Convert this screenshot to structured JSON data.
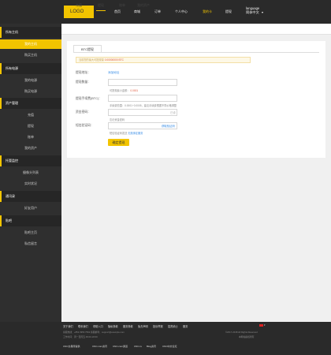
{
  "header": {
    "logo": "LOGO",
    "nav": [
      "首页",
      "商城",
      "订单",
      "个人中心",
      "我的卡",
      "提现"
    ],
    "active_nav": "我的卡",
    "lang_title": "language",
    "lang_value": "简体中文"
  },
  "sidebar": [
    {
      "type": "head",
      "label": "所有主机"
    },
    {
      "type": "sub",
      "label": "我的主机",
      "active": true
    },
    {
      "type": "sub",
      "label": "购买主机"
    },
    {
      "type": "head",
      "label": "所有电源"
    },
    {
      "type": "sub",
      "label": "我的电源"
    },
    {
      "type": "sub",
      "label": "购买电源"
    },
    {
      "type": "head",
      "label": "资产管理"
    },
    {
      "type": "sub",
      "label": "充值"
    },
    {
      "type": "sub",
      "label": "提现"
    },
    {
      "type": "sub",
      "label": "账单"
    },
    {
      "type": "sub",
      "label": "我的资产"
    },
    {
      "type": "head",
      "label": "托管监控"
    },
    {
      "type": "sub",
      "label": "摄像头列表"
    },
    {
      "type": "sub",
      "label": "实时状况"
    },
    {
      "type": "head",
      "label": "通讯录"
    },
    {
      "type": "sub",
      "label": "好友用户"
    },
    {
      "type": "head",
      "label": "贴吧"
    },
    {
      "type": "sub",
      "label": "贴吧主页"
    },
    {
      "type": "sub",
      "label": "私信留言"
    }
  ],
  "tabs": [
    "充值",
    "提现",
    "账单",
    "我的资产"
  ],
  "active_tab": "提现",
  "subtab": "BTC提现",
  "notice": {
    "text": "当前您的最大可提现量",
    "amount": "0.00000000 BTC"
  },
  "form": {
    "address_label": "提现地址：",
    "address_value": "添加地址",
    "amount_label": "提现数量：",
    "amount_hint": "可提现最小金额：",
    "amount_hint_value": "0.0001",
    "fee_label": "提现手续费(BTC)：",
    "fee_hint": "手续费范围：0.0001~0.0005，建议手续费根据不同价格调整",
    "password_label": "资金密码：",
    "password_suffix": "已设",
    "forgot_link": "忘记资金密码",
    "sms_label": "短信验证码：",
    "sms_hint": "短信验证码发送",
    "sms_hint_link": "无需绑定服务",
    "sms_button": "获取验证码",
    "submit": "确定提现"
  },
  "footer": {
    "links": [
      "关于我们",
      "联系我们",
      "帮助入口",
      "隐私条款",
      "服务条款",
      "免责声明",
      "投诉举报",
      "招贤纳士",
      "服务"
    ],
    "line1": "客服热线：+852 3956 7592  客服邮件：support@example.com",
    "line2": "工作时间：周一至周五 09:00-18:00",
    "copyright": "©2017-2018 All Rights Reserved",
    "icp": "本网站版权所有",
    "bottom": [
      "CNC交易所提供",
      "CNC.com资讯",
      "CNC.com通道",
      "CNC.ru",
      "Blog资讯",
      "CNC中文论坛"
    ],
    "accent": "#f2c400"
  }
}
